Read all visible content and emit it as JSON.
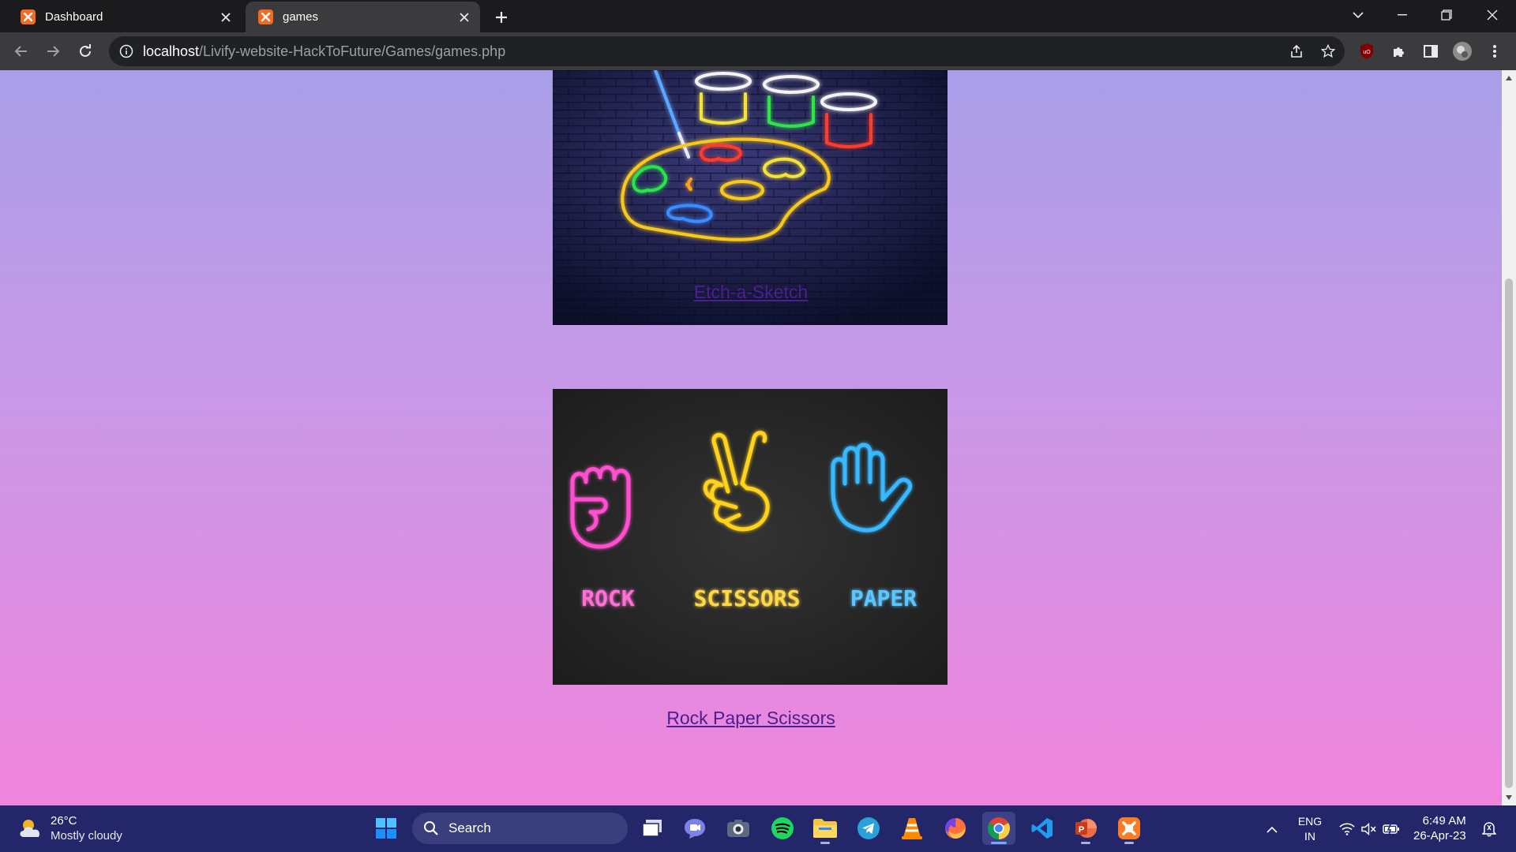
{
  "browser": {
    "tabs": [
      {
        "title": "Dashboard",
        "active": false
      },
      {
        "title": "games",
        "active": true
      }
    ],
    "url": {
      "host": "localhost",
      "path": "/Livify-website-HackToFuture/Games/games.php"
    },
    "extension_badge": "uO"
  },
  "page": {
    "games": [
      {
        "name": "Etch-a-Sketch",
        "image": "neon-paint-palette"
      },
      {
        "name": "Rock Paper Scissors",
        "image": "neon-rock-paper-scissors",
        "image_labels": [
          "ROCK",
          "SCISSORS",
          "PAPER"
        ]
      }
    ],
    "background_top": "#a99fe9",
    "background_bottom": "#f184dd",
    "link_color": "#4a1f8e"
  },
  "taskbar": {
    "weather": {
      "temp": "26°C",
      "condition": "Mostly cloudy"
    },
    "search_placeholder": "Search",
    "apps": [
      "task-view",
      "teams-meet",
      "camera",
      "spotify",
      "file-explorer",
      "telegram",
      "vlc",
      "firefox",
      "chrome",
      "vscode",
      "powerpoint",
      "xampp"
    ],
    "language": {
      "line1": "ENG",
      "line2": "IN"
    },
    "clock": {
      "time": "6:49 AM",
      "date": "26-Apr-23"
    }
  }
}
